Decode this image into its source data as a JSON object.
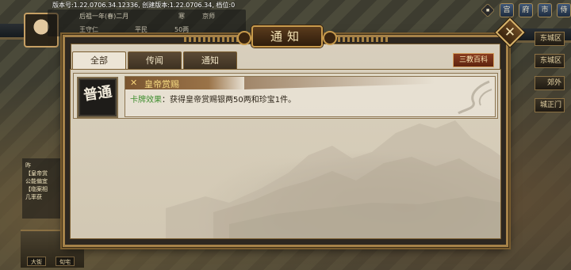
{
  "hud": {
    "version_text": "版本号:1.22.0706.34.12336,  创建版本:1.22.0706.34, 档位:0",
    "era": "后祖一年(春)二月",
    "weather": "寒",
    "location": "京师",
    "role_a": "王守仁",
    "role_b": "平民",
    "money": "50两",
    "left_info": [
      "昨",
      "【皇帝赏",
      "公能偏宜",
      "【临案相",
      "几率获"
    ],
    "bottom_buttons": [
      "大街",
      "旬宅"
    ],
    "side_buttons": [
      "东城区",
      "东城区",
      "郊外",
      "城正门"
    ],
    "top_icons": [
      "◆",
      "宫",
      "府",
      "市",
      "侍"
    ]
  },
  "dialog": {
    "title": "通知",
    "close_label": "✕",
    "tabs": [
      {
        "label": "全部",
        "active": true
      },
      {
        "label": "传闻",
        "active": false
      },
      {
        "label": "通知",
        "active": false
      }
    ],
    "encyclopedia_label": "三教百科",
    "cards": [
      {
        "badge": "普通",
        "title": "皇帝赏赐",
        "icon": "cross-swords-icon",
        "desc_label": "卡牌效果",
        "desc_sep": "：",
        "desc_text": "获得皇帝赏赐银两50两和珍宝1件。"
      }
    ]
  },
  "colors": {
    "frame_gold": "#a68249",
    "parchment": "#d8cfbc",
    "effect_green": "#3f8e2f",
    "title_gold": "#f4d880"
  }
}
